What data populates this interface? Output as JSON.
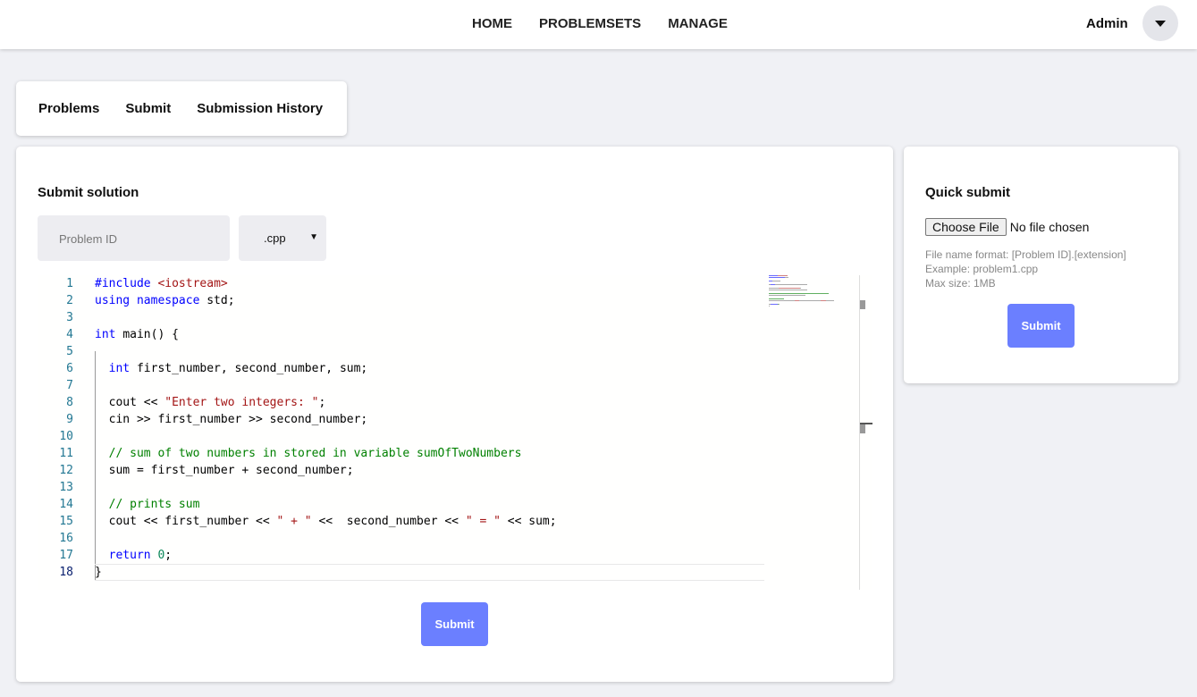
{
  "nav": {
    "items": [
      "HOME",
      "PROBLEMSETS",
      "MANAGE"
    ],
    "user": "Admin"
  },
  "tabs": [
    "Problems",
    "Submit",
    "Submission History"
  ],
  "submit": {
    "title": "Submit solution",
    "problem_id_placeholder": "Problem ID",
    "language": ".cpp",
    "button": "Submit",
    "code": [
      [
        [
          "k",
          "#include "
        ],
        [
          "s",
          "<iostream>"
        ]
      ],
      [
        [
          "k",
          "using namespace "
        ],
        [
          "p",
          "std;"
        ]
      ],
      [],
      [
        [
          "k",
          "int "
        ],
        [
          "p",
          "main() {"
        ]
      ],
      [],
      [
        [
          "p",
          "  "
        ],
        [
          "k",
          "int "
        ],
        [
          "p",
          "first_number, second_number, sum;"
        ]
      ],
      [],
      [
        [
          "p",
          "  cout << "
        ],
        [
          "s",
          "\"Enter two integers: \""
        ],
        [
          "p",
          ";"
        ]
      ],
      [
        [
          "p",
          "  cin >> first_number >> second_number;"
        ]
      ],
      [],
      [
        [
          "c",
          "  // sum of two numbers in stored in variable sumOfTwoNumbers"
        ]
      ],
      [
        [
          "p",
          "  sum = first_number + second_number;"
        ]
      ],
      [],
      [
        [
          "c",
          "  // prints sum"
        ]
      ],
      [
        [
          "p",
          "  cout << first_number << "
        ],
        [
          "s",
          "\" + \""
        ],
        [
          "p",
          " <<  second_number << "
        ],
        [
          "s",
          "\" = \""
        ],
        [
          "p",
          " << sum;"
        ]
      ],
      [],
      [
        [
          "p",
          "  "
        ],
        [
          "k",
          "return "
        ],
        [
          "n",
          "0"
        ],
        [
          "p",
          ";"
        ]
      ],
      [
        [
          "p",
          "}"
        ]
      ]
    ]
  },
  "quick": {
    "title": "Quick submit",
    "choose_file": "Choose File",
    "no_file": "No file chosen",
    "hints": [
      "File name format: [Problem ID].[extension]",
      "Example: problem1.cpp",
      "Max size: 1MB"
    ],
    "button": "Submit"
  },
  "colors": {
    "accent": "#6b7fff",
    "keyword": "#0000ff",
    "string": "#a31515",
    "comment": "#008000"
  }
}
